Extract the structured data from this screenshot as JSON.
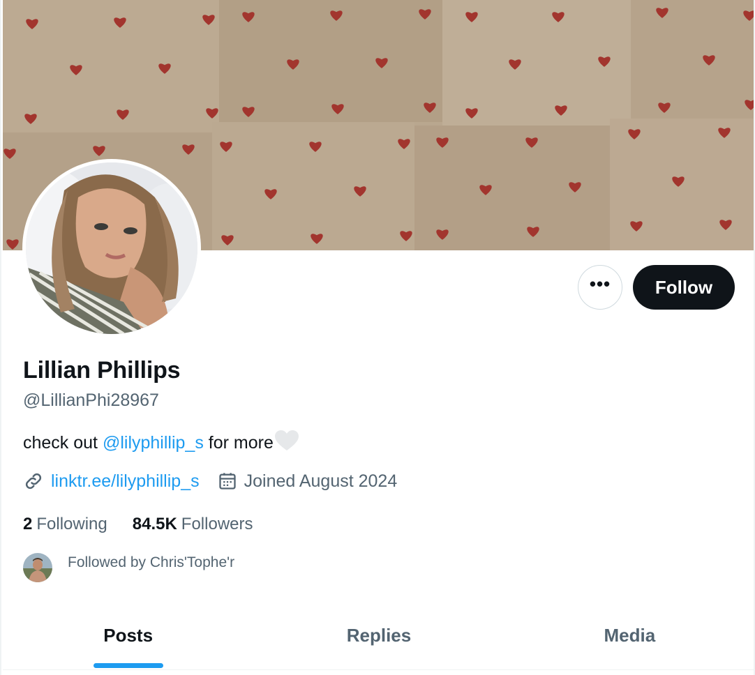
{
  "profile": {
    "display_name": "Lillian Phillips",
    "handle": "@LillianPhi28967",
    "bio_prefix": "check out ",
    "bio_mention": "@lilyphillip_s",
    "bio_suffix": " for more",
    "bio_emoji": "white-heart",
    "website": "linktr.ee/lilyphillip_s",
    "joined": "Joined August 2024"
  },
  "actions": {
    "more_icon": "•••",
    "follow_label": "Follow"
  },
  "stats": {
    "following_count": "2",
    "following_label": "Following",
    "followers_count": "84.5K",
    "followers_label": "Followers"
  },
  "followed_by": {
    "text": "Followed by Chris'Tophe'r"
  },
  "tabs": [
    {
      "label": "Posts",
      "active": true
    },
    {
      "label": "Replies",
      "active": false
    },
    {
      "label": "Media",
      "active": false
    }
  ],
  "colors": {
    "accent": "#1d9bf0",
    "text_primary": "#0f1419",
    "text_secondary": "#536471",
    "follow_bg": "#0f1419",
    "banner_bg": "#b9a78f",
    "banner_heart": "#a2352e"
  },
  "icons": {
    "website": "link-icon",
    "joined": "calendar-icon",
    "more": "more-horizontal-icon"
  }
}
